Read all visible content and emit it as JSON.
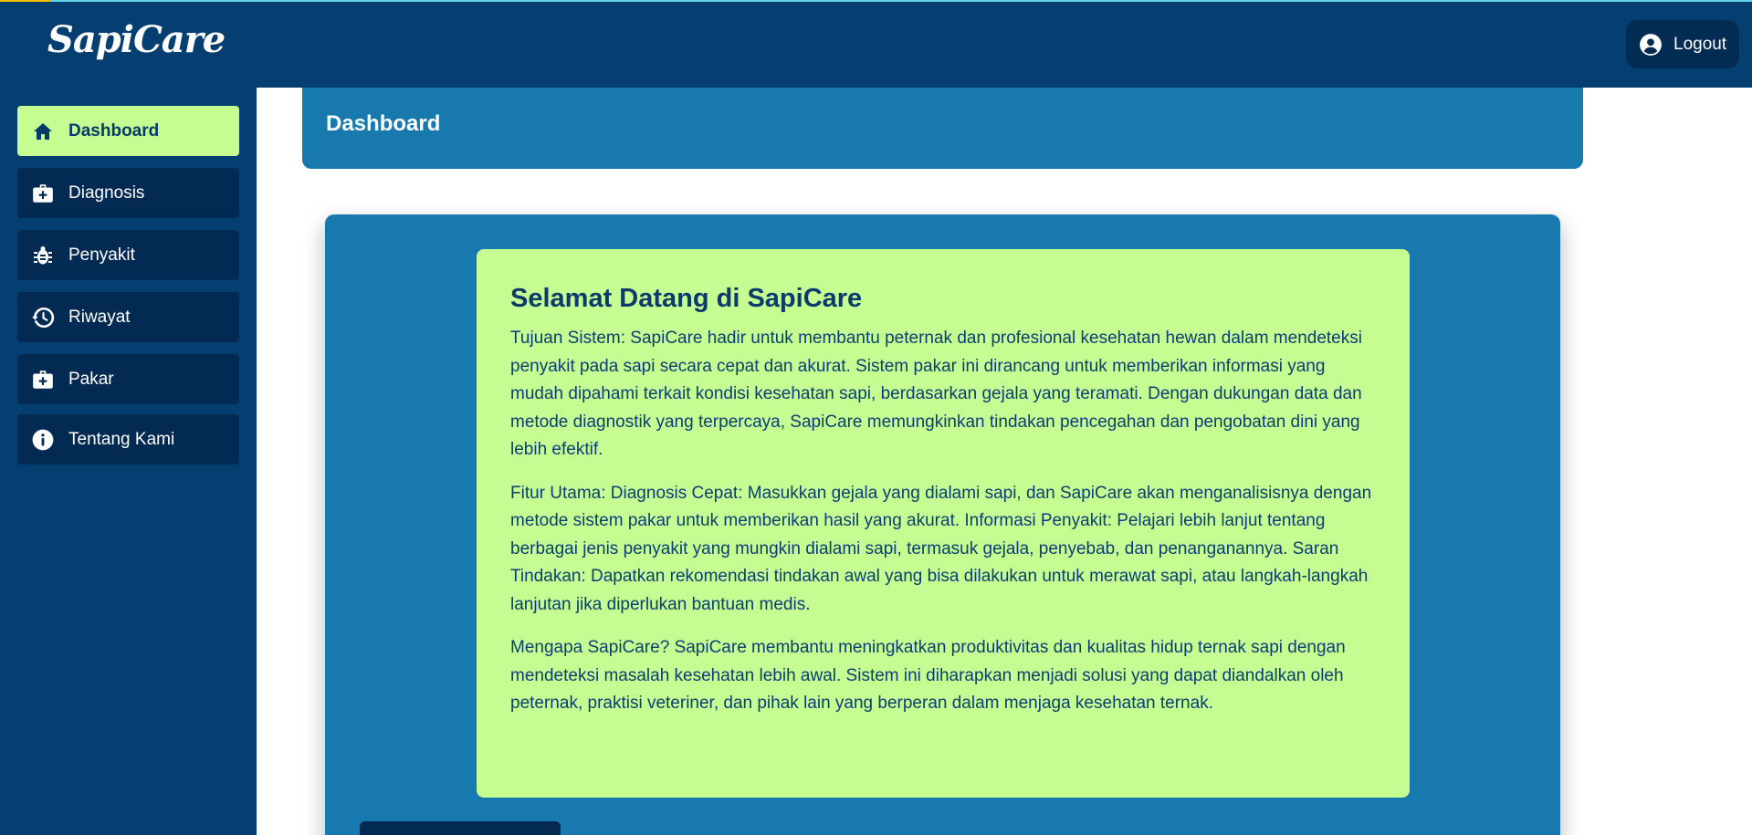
{
  "brand": {
    "name": "SapiCare"
  },
  "header": {
    "logout_label": "Logout"
  },
  "sidebar": {
    "items": [
      {
        "label": "Dashboard",
        "icon": "home-icon"
      },
      {
        "label": "Diagnosis",
        "icon": "medical-kit-icon"
      },
      {
        "label": "Penyakit",
        "icon": "bug-icon"
      },
      {
        "label": "Riwayat",
        "icon": "history-icon"
      },
      {
        "label": "Pakar",
        "icon": "medical-kit-icon"
      },
      {
        "label": "Tentang Kami",
        "icon": "info-icon"
      }
    ]
  },
  "page": {
    "title": "Dashboard"
  },
  "welcome": {
    "title": "Selamat Datang di SapiCare",
    "p1": "Tujuan Sistem: SapiCare hadir untuk membantu peternak dan profesional kesehatan hewan dalam mendeteksi penyakit pada sapi secara cepat dan akurat. Sistem pakar ini dirancang untuk memberikan informasi yang mudah dipahami terkait kondisi kesehatan sapi, berdasarkan gejala yang teramati. Dengan dukungan data dan metode diagnostik yang terpercaya, SapiCare memungkinkan tindakan pencegahan dan pengobatan dini yang lebih efektif.",
    "p2": "Fitur Utama: Diagnosis Cepat: Masukkan gejala yang dialami sapi, dan SapiCare akan menganalisisnya dengan metode sistem pakar untuk memberikan hasil yang akurat. Informasi Penyakit: Pelajari lebih lanjut tentang berbagai jenis penyakit yang mungkin dialami sapi, termasuk gejala, penyebab, dan penanganannya. Saran Tindakan: Dapatkan rekomendasi tindakan awal yang bisa dilakukan untuk merawat sapi, atau langkah-langkah lanjutan jika diperlukan bantuan medis.",
    "p3": "Mengapa SapiCare? SapiCare membantu meningkatkan produktivitas dan kualitas hidup ternak sapi dengan mendeteksi masalah kesehatan lebih awal. Sistem ini diharapkan menjadi solusi yang dapat diandalkan oleh peternak, praktisi veteriner, dan pihak lain yang berperan dalam menjaga kesehatan ternak."
  },
  "colors": {
    "navbar": "#053f72",
    "sidebar_item": "#032a52",
    "active_item": "#c6fd93",
    "card": "#1779ae",
    "text_dark": "#0b3f73"
  }
}
